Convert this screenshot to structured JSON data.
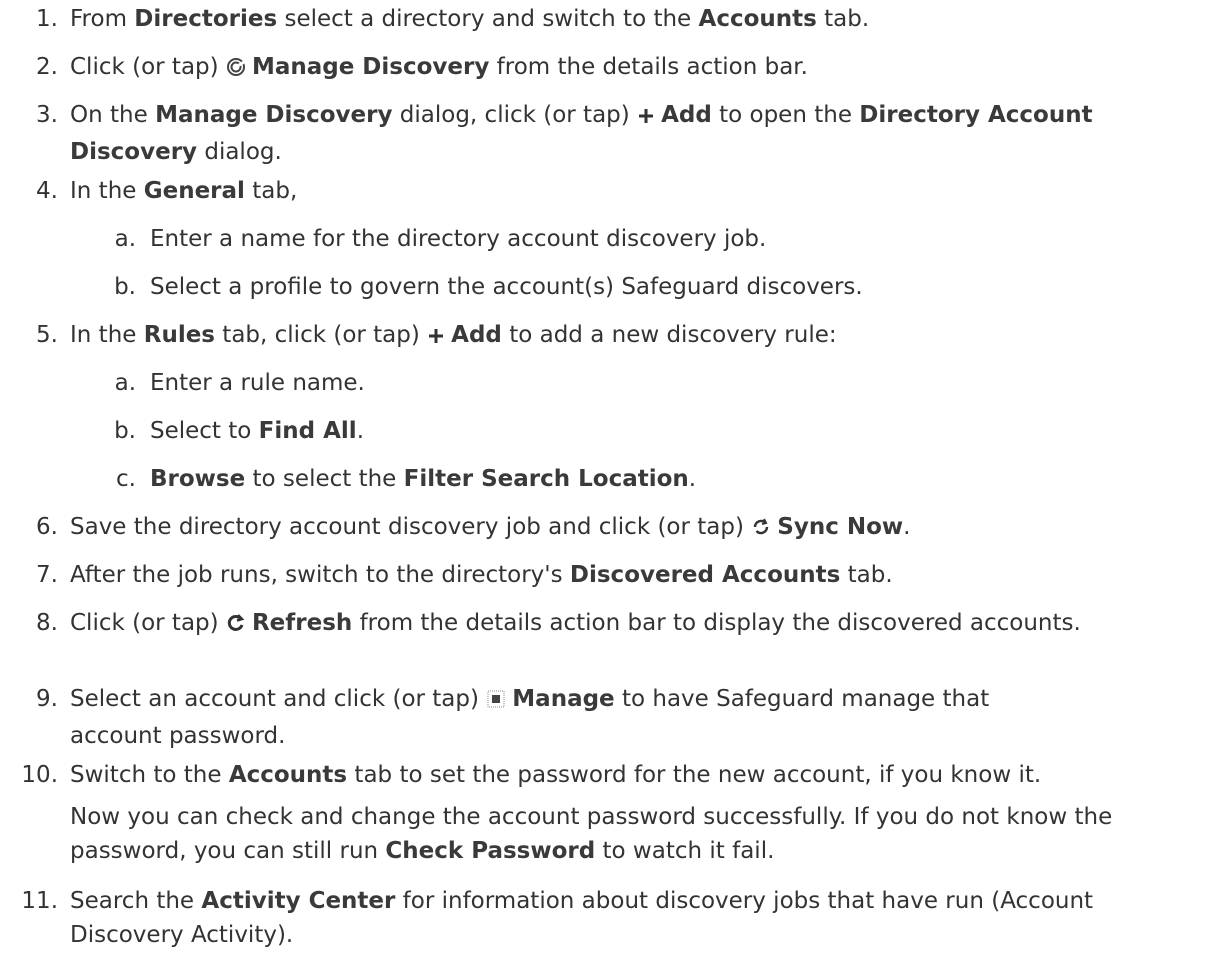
{
  "steps": [
    {
      "num": "1.",
      "parts": [
        {
          "t": "From "
        },
        {
          "b": "Directories"
        },
        {
          "t": " select a directory and switch to the "
        },
        {
          "b": "Accounts"
        },
        {
          "t": " tab."
        }
      ]
    },
    {
      "num": "2.",
      "parts": [
        {
          "t": "Click (or tap) "
        },
        {
          "icon": "manage-discovery-icon"
        },
        {
          "b": "Manage Discovery"
        },
        {
          "t": " from the details action bar."
        }
      ]
    },
    {
      "num": "3.",
      "parts": [
        {
          "t": "On the "
        },
        {
          "b": "Manage Discovery"
        },
        {
          "t": " dialog, click (or tap) "
        },
        {
          "icon": "plus-icon"
        },
        {
          "b": "Add"
        },
        {
          "t": " to open the "
        },
        {
          "b": "Directory Account Discovery"
        },
        {
          "t": " dialog."
        }
      ]
    },
    {
      "num": "4.",
      "parts": [
        {
          "t": "In the "
        },
        {
          "b": "General"
        },
        {
          "t": " tab,"
        }
      ],
      "subs": [
        {
          "label": "a.",
          "parts": [
            {
              "t": "Enter a name for the directory account discovery job."
            }
          ]
        },
        {
          "label": "b.",
          "parts": [
            {
              "t": "Select a profile to govern the account(s) Safeguard discovers."
            }
          ]
        }
      ]
    },
    {
      "num": "5.",
      "parts": [
        {
          "t": "In the "
        },
        {
          "b": "Rules"
        },
        {
          "t": " tab, click (or tap) "
        },
        {
          "icon": "plus-icon"
        },
        {
          "b": "Add"
        },
        {
          "t": " to add a new discovery rule:"
        }
      ],
      "subs": [
        {
          "label": "a.",
          "parts": [
            {
              "t": "Enter a rule name."
            }
          ]
        },
        {
          "label": "b.",
          "parts": [
            {
              "t": "Select to "
            },
            {
              "b": "Find All"
            },
            {
              "t": "."
            }
          ]
        },
        {
          "label": "c.",
          "parts": [
            {
              "b": "Browse"
            },
            {
              "t": " to select the "
            },
            {
              "b": "Filter Search Location"
            },
            {
              "t": "."
            }
          ]
        }
      ]
    },
    {
      "num": "6.",
      "parts": [
        {
          "t": "Save the directory account discovery job and click (or tap) "
        },
        {
          "icon": "sync-icon"
        },
        {
          "b": "Sync Now"
        },
        {
          "t": "."
        }
      ]
    },
    {
      "num": "7.",
      "parts": [
        {
          "t": "After the job runs, switch to the directory's "
        },
        {
          "b": "Discovered Accounts"
        },
        {
          "t": " tab."
        }
      ]
    },
    {
      "num": "8.",
      "justify": true,
      "parts": [
        {
          "t": "Click (or tap) "
        },
        {
          "icon": "refresh-icon"
        },
        {
          "b": "Refresh"
        },
        {
          "t": " from the details action bar to display the discovered accounts."
        }
      ]
    },
    {
      "num": "9.",
      "parts": [
        {
          "t": "Select an account and click (or tap) "
        },
        {
          "icon": "manage-icon"
        },
        {
          "b": "Manage"
        },
        {
          "t": " to have Safeguard manage that account password."
        }
      ]
    },
    {
      "num": "10.",
      "parts": [
        {
          "t": "Switch to the "
        },
        {
          "b": "Accounts"
        },
        {
          "t": " tab to set the password for the new account, if you know it."
        }
      ],
      "para": [
        {
          "t": "Now you can check and change the account password successfully. If you do not know the password, you can still run "
        },
        {
          "b": "Check Password"
        },
        {
          "t": " to watch it fail."
        }
      ]
    },
    {
      "num": "11.",
      "parts": [
        {
          "t": "Search the "
        },
        {
          "b": "Activity Center"
        },
        {
          "t": " for information about discovery jobs that have run (Account Discovery Activity)."
        }
      ]
    }
  ]
}
